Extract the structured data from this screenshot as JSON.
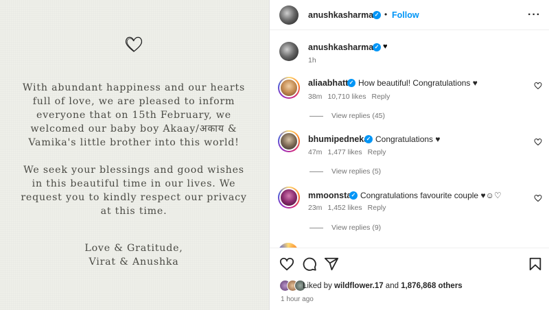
{
  "image": {
    "announcement": "With abundant happiness and our hearts full of love, we are pleased to inform everyone that on 15th February, we welcomed our baby boy Akaay/अकाय & Vamika's little brother into this world!\n\nWe seek your blessings and good wishes in this beautiful time in our lives. We request you to kindly respect our privacy at this time.",
    "signoff": "Love & Gratitude,\nVirat & Anushka",
    "bg_color": "#eeefe9"
  },
  "header": {
    "username": "anushkasharma",
    "separator": "•",
    "follow_label": "Follow",
    "more_label": "···"
  },
  "caption": {
    "username": "anushkasharma",
    "text": "♥",
    "time": "1h"
  },
  "comments": [
    {
      "username": "aliaabhatt",
      "text": "How beautiful! Congratulations ♥",
      "time": "38m",
      "likes": "10,710 likes",
      "reply": "Reply",
      "view_replies": "View replies (45)"
    },
    {
      "username": "bhumipednekar",
      "text": "Congratulations ♥",
      "time": "47m",
      "likes": "1,477 likes",
      "reply": "Reply",
      "view_replies": "View replies (5)"
    },
    {
      "username": "mmoonstar",
      "text": "Congratulations favourite couple ♥☺︎♡",
      "time": "23m",
      "likes": "1,452 likes",
      "reply": "Reply",
      "view_replies": "View replies (9)"
    }
  ],
  "footer": {
    "liked_prefix": "Liked by ",
    "liked_user": "wildflower.17",
    "liked_and": " and ",
    "liked_count": "1,876,868 others",
    "post_time": "1 hour ago"
  },
  "icons": [
    "heart-icon",
    "comment-icon",
    "share-icon",
    "bookmark-icon",
    "verified-icon",
    "more-icon"
  ],
  "colors": {
    "accent": "#0095f6",
    "text": "#262626",
    "muted": "#737373"
  }
}
